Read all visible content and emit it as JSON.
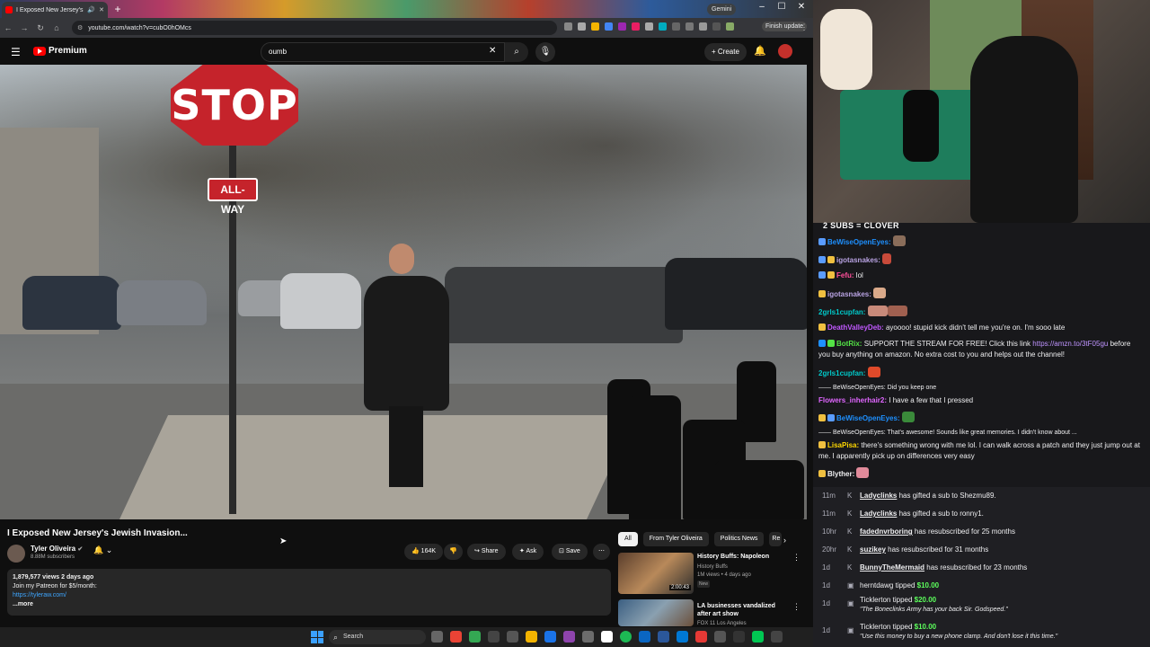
{
  "browser": {
    "tab_title": "I Exposed New Jersey's Jew",
    "gemini_label": "Gemini",
    "url": "youtube.com/watch?v=cubO0hOMcs",
    "finish_update": "Finish update"
  },
  "youtube": {
    "logo_text": "Premium",
    "search_value": "oumb",
    "create_label": "Create"
  },
  "video": {
    "stop_sign": "STOP",
    "all_way_sign": "ALL-WAY",
    "title": "I Exposed New Jersey's Jewish Invasion...",
    "channel": "Tyler Oliveira",
    "subscribers": "8.88M subscribers",
    "likes": "164K",
    "share": "Share",
    "ask": "Ask",
    "save": "Save",
    "description": {
      "stats": "1,879,577 views  2 days ago",
      "line1": "Join my Patreon for $5/month:",
      "link": "https://tyleraw.com/",
      "more": "...more"
    }
  },
  "recommendations": {
    "chips": [
      "All",
      "From Tyler Oliveira",
      "Politics News",
      "Re"
    ],
    "items": [
      {
        "title": "History Buffs: Napoleon",
        "channel": "History Buffs",
        "meta": "1M views • 4 days ago",
        "badge": "New",
        "duration": "2:00:43"
      },
      {
        "title": "LA businesses vandalized after art show",
        "channel": "FOX 11 Los Angeles",
        "meta": "",
        "badge": "",
        "duration": ""
      }
    ]
  },
  "taskbar": {
    "search_label": "Search"
  },
  "stream": {
    "subs_goal": "2 SUBS = CLOVER",
    "chat": [
      {
        "name": "BeWiseOpenEyes:",
        "text": "",
        "color": "#1e90ff"
      },
      {
        "name": "igotasnakes:",
        "text": "",
        "color": "#b9a3e3"
      },
      {
        "name": "Fefu:",
        "text": "lol",
        "color": "#ff4f9a"
      },
      {
        "name": "igotasnakes:",
        "text": "",
        "color": "#b9a3e3"
      },
      {
        "name": "2grls1cupfan:",
        "text": "",
        "color": "#00c8c8"
      },
      {
        "name": "DeathValleyDeb:",
        "text": "ayoooo! stupid kick didn't tell me you're on. I'm sooo late",
        "color": "#c058ff"
      },
      {
        "name": "BotRix:",
        "text": "SUPPORT THE STREAM FOR FREE! Click this link",
        "link": "https://amzn.to/3tF05gu",
        "text2": "before you buy anything on amazon. No extra cost to you and helps out the channel!",
        "color": "#54e346"
      },
      {
        "name": "2grls1cupfan:",
        "text": "",
        "color": "#00c8c8"
      },
      {
        "reply": "BeWiseOpenEyes: Did you keep one"
      },
      {
        "name": "Flowers_inherhair2:",
        "text": "I have a few that I pressed",
        "color": "#e066ff"
      },
      {
        "name": "BeWiseOpenEyes:",
        "text": "",
        "color": "#1e90ff"
      },
      {
        "reply": "BeWiseOpenEyes: That's awesome! Sounds like great memories. I didn't know about ..."
      },
      {
        "name": "LisaPisa:",
        "text": "there's something wrong with me lol. I can walk across a patch and they just jump out at me. I apparently pick up on differences very easy",
        "color": "#ffd700"
      },
      {
        "name": "Blyther:",
        "text": "",
        "color": "#efeff1"
      }
    ],
    "events": [
      {
        "time": "11m",
        "who": "Ladyclinks",
        "text": "has gifted a sub to Shezmu89."
      },
      {
        "time": "11m",
        "who": "Ladyclinks",
        "text": "has gifted a sub to ronny1."
      },
      {
        "time": "10hr",
        "who": "fadednvrboring",
        "text": "has resubscribed for 25 months"
      },
      {
        "time": "20hr",
        "who": "suzikey",
        "text": "has resubscribed for 31 months"
      },
      {
        "time": "1d",
        "who": "BunnyTheMermaid",
        "text": "has resubscribed for 23 months"
      },
      {
        "time": "1d",
        "who": "herntdawg",
        "text": "tipped",
        "amount": "$10.00"
      },
      {
        "time": "1d",
        "who": "Ticklerton",
        "text": "tipped",
        "amount": "$20.00",
        "quote": "\"The Boneclinks Army has your back Sir. Godspeed.\""
      },
      {
        "time": "1d",
        "who": "Ticklerton",
        "text": "tipped",
        "amount": "$10.00",
        "quote": "\"Use this money to buy a new phone clamp. And don't lose it this time.\""
      }
    ]
  }
}
